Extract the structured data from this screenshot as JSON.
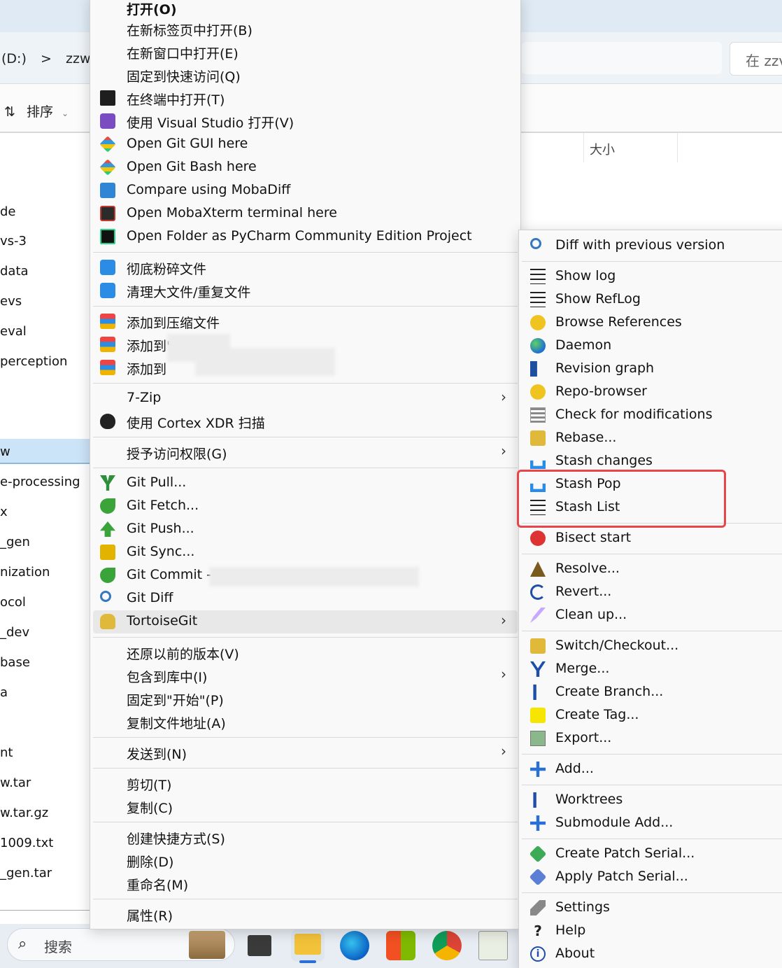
{
  "explorer": {
    "address_parts": [
      "(D:)",
      ">",
      "zzw"
    ],
    "search_placeholder": "在 zzv",
    "sort_label": "排序",
    "size_column": "大小",
    "files": [
      "de",
      "vs-3",
      "data",
      "evs",
      "eval",
      "perception",
      "w",
      "e-processing",
      "x",
      "_gen",
      "nization",
      "ocol",
      "_dev",
      "base",
      "a",
      "nt",
      "w.tar",
      "w.tar.gz",
      "1009.txt",
      "_gen.tar"
    ]
  },
  "taskbar": {
    "search_label": "搜索"
  },
  "main_menu": {
    "items": [
      {
        "label": "打开(O)",
        "icon": ""
      },
      {
        "label": "在新标签页中打开(B)",
        "icon": ""
      },
      {
        "label": "在新窗口中打开(E)",
        "icon": ""
      },
      {
        "label": "固定到快速访问(Q)",
        "icon": ""
      },
      {
        "label": "在终端中打开(T)",
        "icon": "terminal-icon"
      },
      {
        "label": "使用 Visual Studio 打开(V)",
        "icon": "visual-studio-icon"
      },
      {
        "label": "Open Git GUI here",
        "icon": "git-gui-icon"
      },
      {
        "label": "Open Git Bash here",
        "icon": "git-bash-icon"
      },
      {
        "label": "Compare using MobaDiff",
        "icon": "mobadiff-icon"
      },
      {
        "label": "Open MobaXterm terminal here",
        "icon": "mobaxterm-icon"
      },
      {
        "label": "Open Folder as PyCharm Community Edition Project",
        "icon": "pycharm-icon"
      },
      {
        "label": "彻底粉碎文件",
        "icon": "shred-icon"
      },
      {
        "label": "清理大文件/重复文件",
        "icon": "cleanup-icon"
      },
      {
        "label": "添加到压缩文件",
        "icon": "archive-icon"
      },
      {
        "label": "添加到\"",
        "icon": "archive-icon"
      },
      {
        "label": "添加到",
        "icon": "archive-icon"
      },
      {
        "label": "7-Zip",
        "icon": ""
      },
      {
        "label": "使用 Cortex XDR 扫描",
        "icon": "shield-icon"
      },
      {
        "label": "授予访问权限(G)",
        "icon": ""
      },
      {
        "label": "Git Pull...",
        "icon": "git-pull-icon"
      },
      {
        "label": "Git Fetch...",
        "icon": "git-fetch-icon"
      },
      {
        "label": "Git Push...",
        "icon": "git-push-icon"
      },
      {
        "label": "Git Sync...",
        "icon": "git-sync-icon"
      },
      {
        "label": "Git Commit ->",
        "icon": "git-commit-icon"
      },
      {
        "label": "Git Diff",
        "icon": "git-diff-icon"
      },
      {
        "label": "TortoiseGit",
        "icon": "tortoisegit-icon"
      },
      {
        "label": "还原以前的版本(V)",
        "icon": ""
      },
      {
        "label": "包含到库中(I)",
        "icon": ""
      },
      {
        "label": "固定到\"开始\"(P)",
        "icon": ""
      },
      {
        "label": "复制文件地址(A)",
        "icon": ""
      },
      {
        "label": "发送到(N)",
        "icon": ""
      },
      {
        "label": "剪切(T)",
        "icon": ""
      },
      {
        "label": "复制(C)",
        "icon": ""
      },
      {
        "label": "创建快捷方式(S)",
        "icon": ""
      },
      {
        "label": "删除(D)",
        "icon": ""
      },
      {
        "label": "重命名(M)",
        "icon": ""
      },
      {
        "label": "属性(R)",
        "icon": ""
      }
    ]
  },
  "sub_menu": {
    "items": [
      {
        "label": "Diff with previous version",
        "icon": "diff-icon"
      },
      {
        "label": "Show log",
        "icon": "log-icon"
      },
      {
        "label": "Show RefLog",
        "icon": "reflog-icon"
      },
      {
        "label": "Browse References",
        "icon": "references-icon"
      },
      {
        "label": "Daemon",
        "icon": "globe-icon"
      },
      {
        "label": "Revision graph",
        "icon": "revision-graph-icon"
      },
      {
        "label": "Repo-browser",
        "icon": "repo-browser-icon"
      },
      {
        "label": "Check for modifications",
        "icon": "check-modifications-icon"
      },
      {
        "label": "Rebase...",
        "icon": "rebase-icon"
      },
      {
        "label": "Stash changes",
        "icon": "stash-icon"
      },
      {
        "label": "Stash Pop",
        "icon": "stash-pop-icon"
      },
      {
        "label": "Stash List",
        "icon": "stash-list-icon"
      },
      {
        "label": "Bisect start",
        "icon": "bisect-icon"
      },
      {
        "label": "Resolve...",
        "icon": "resolve-icon"
      },
      {
        "label": "Revert...",
        "icon": "revert-icon"
      },
      {
        "label": "Clean up...",
        "icon": "cleanup-brush-icon"
      },
      {
        "label": "Switch/Checkout...",
        "icon": "switch-icon"
      },
      {
        "label": "Merge...",
        "icon": "merge-icon"
      },
      {
        "label": "Create Branch...",
        "icon": "branch-icon"
      },
      {
        "label": "Create Tag...",
        "icon": "tag-icon"
      },
      {
        "label": "Export...",
        "icon": "export-icon"
      },
      {
        "label": "Add...",
        "icon": "add-icon"
      },
      {
        "label": "Worktrees",
        "icon": "worktree-icon"
      },
      {
        "label": "Submodule Add...",
        "icon": "submodule-add-icon"
      },
      {
        "label": "Create Patch Serial...",
        "icon": "create-patch-icon"
      },
      {
        "label": "Apply Patch Serial...",
        "icon": "apply-patch-icon"
      },
      {
        "label": "Settings",
        "icon": "wrench-icon"
      },
      {
        "label": "Help",
        "icon": "help-icon"
      },
      {
        "label": "About",
        "icon": "info-icon"
      }
    ]
  },
  "colors": {
    "highlight_border": "#e8454a",
    "selected_row": "#cce4f7"
  }
}
